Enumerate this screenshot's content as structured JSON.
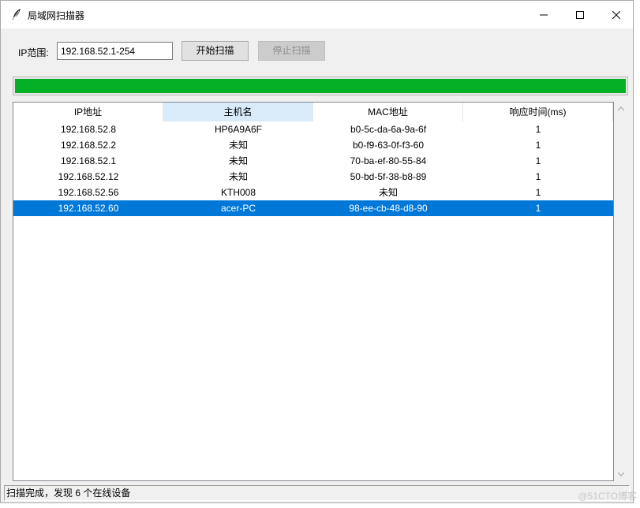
{
  "window": {
    "title": "局域网扫描器"
  },
  "toolbar": {
    "ip_range_label": "IP范围:",
    "ip_range_value": "192.168.52.1-254",
    "start_button": "开始扫描",
    "stop_button": "停止扫描"
  },
  "progress": {
    "fraction": 1.0,
    "color": "#06b025"
  },
  "table": {
    "columns": [
      "IP地址",
      "主机名",
      "MAC地址",
      "响应时间(ms)"
    ],
    "rows": [
      [
        "192.168.52.8",
        "HP6A9A6F",
        "b0-5c-da-6a-9a-6f",
        "1"
      ],
      [
        "192.168.52.2",
        "未知",
        "b0-f9-63-0f-f3-60",
        "1"
      ],
      [
        "192.168.52.1",
        "未知",
        "70-ba-ef-80-55-84",
        "1"
      ],
      [
        "192.168.52.12",
        "未知",
        "50-bd-5f-38-b8-89",
        "1"
      ],
      [
        "192.168.52.56",
        "KTH008",
        "未知",
        "1"
      ],
      [
        "192.168.52.60",
        "acer-PC",
        "98-ee-cb-48-d8-90",
        "1"
      ]
    ],
    "selected_row": 5,
    "hovered_column": 1
  },
  "status": {
    "text": "扫描完成，发现 6 个在线设备"
  },
  "watermark": "@51CTO博客",
  "colors": {
    "selection": "#0078d7",
    "header_hover": "#d9ebf9"
  }
}
